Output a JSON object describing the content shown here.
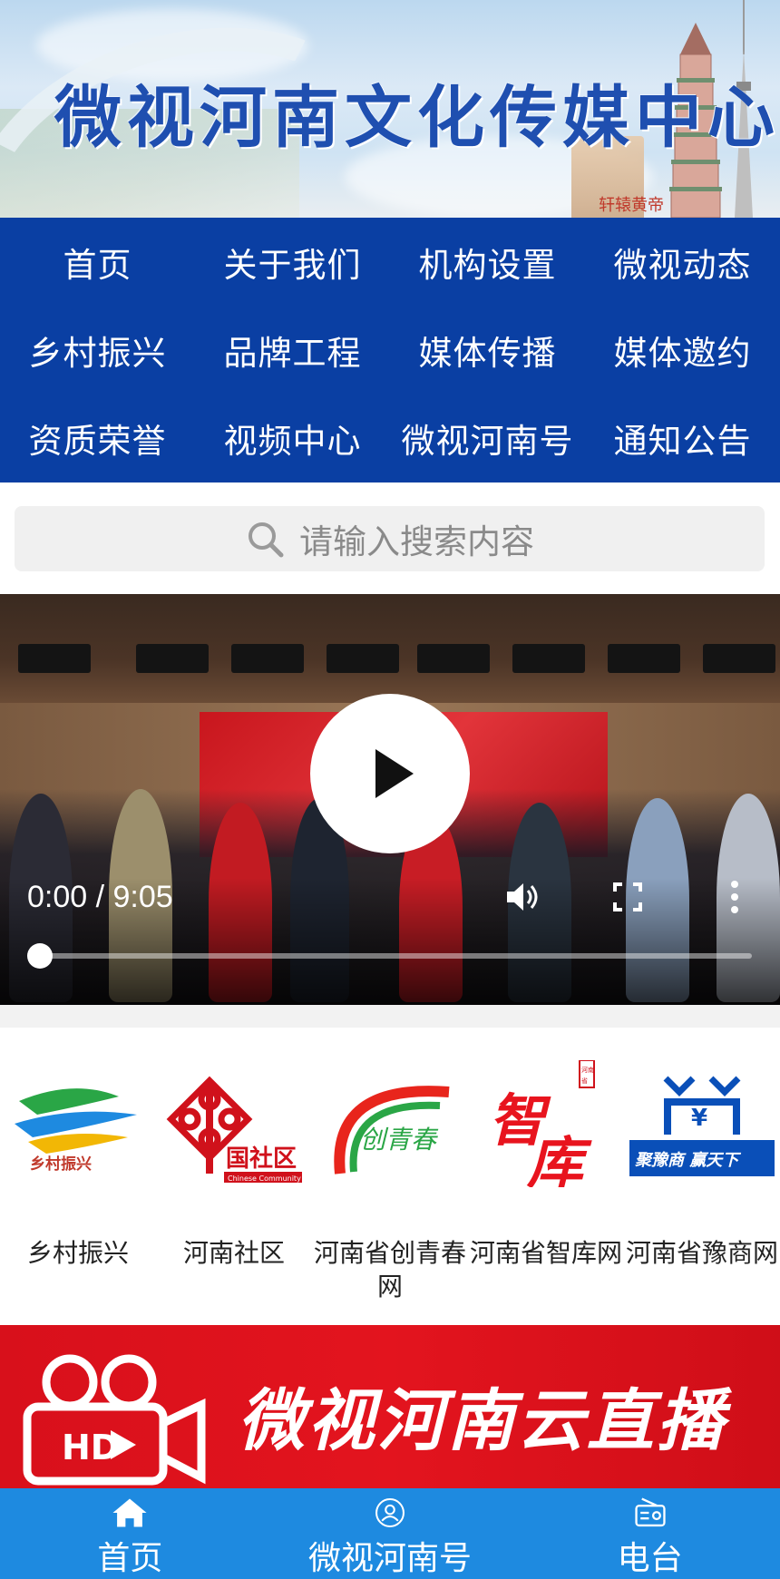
{
  "banner": {
    "title": "微视河南文化传媒中心",
    "seal": "轩辕黄帝"
  },
  "nav": {
    "items": [
      {
        "label": "首页"
      },
      {
        "label": "关于我们"
      },
      {
        "label": "机构设置"
      },
      {
        "label": "微视动态"
      },
      {
        "label": "乡村振兴"
      },
      {
        "label": "品牌工程"
      },
      {
        "label": "媒体传播"
      },
      {
        "label": "媒体邀约"
      },
      {
        "label": "资质荣誉"
      },
      {
        "label": "视频中心"
      },
      {
        "label": "微视河南号"
      },
      {
        "label": "通知公告"
      }
    ]
  },
  "search": {
    "placeholder": "请输入搜索内容",
    "icon": "search-icon"
  },
  "video": {
    "time": "0:00 / 9:05",
    "progress": 0
  },
  "partners": [
    {
      "label": "乡村振兴",
      "logo_text": "乡村振兴"
    },
    {
      "label": "河南社区",
      "logo_text": "中国社区",
      "logo_sub": "Chinese Community"
    },
    {
      "label": "河南省创青春网",
      "logo_text": "创青春"
    },
    {
      "label": "河南省智库网",
      "logo_text": "智库",
      "logo_sub": "河南省"
    },
    {
      "label": "河南省豫商网",
      "logo_text": "聚豫商 赢天下"
    }
  ],
  "live_banner": {
    "title": "微视河南云直播",
    "badge": "HD"
  },
  "tabbar": {
    "items": [
      {
        "label": "首页",
        "icon": "home-icon"
      },
      {
        "label": "微视河南号",
        "icon": "user-icon"
      },
      {
        "label": "电台",
        "icon": "radio-icon"
      }
    ]
  },
  "colors": {
    "nav_bg": "#0a3fa3",
    "tabbar_bg": "#1e8ae0",
    "live_bg": "#d8101b",
    "title_blue": "#1f4fb0"
  }
}
